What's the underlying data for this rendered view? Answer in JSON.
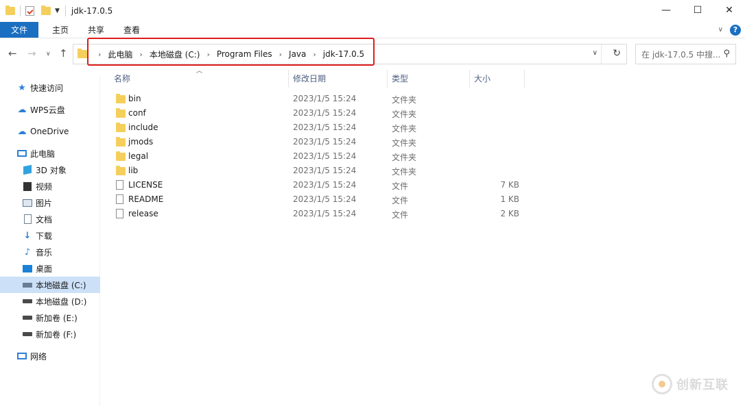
{
  "window": {
    "title": "jdk-17.0.5"
  },
  "ribbon": {
    "tabs": [
      "文件",
      "主页",
      "共享",
      "查看"
    ]
  },
  "address": {
    "crumbs": [
      "此电脑",
      "本地磁盘 (C:)",
      "Program Files",
      "Java",
      "jdk-17.0.5"
    ]
  },
  "search": {
    "placeholder": "在 jdk-17.0.5 中搜..."
  },
  "sidebar": {
    "items": [
      {
        "label": "快速访问",
        "icon": "star-icon"
      },
      {
        "label": "WPS云盘",
        "icon": "cloud-icon"
      },
      {
        "label": "OneDrive",
        "icon": "onedrive-icon"
      },
      {
        "label": "此电脑",
        "icon": "pc-icon"
      },
      {
        "label": "3D 对象",
        "icon": "3d-objects-icon"
      },
      {
        "label": "视频",
        "icon": "video-icon"
      },
      {
        "label": "图片",
        "icon": "pictures-icon"
      },
      {
        "label": "文档",
        "icon": "documents-icon"
      },
      {
        "label": "下载",
        "icon": "download-icon"
      },
      {
        "label": "音乐",
        "icon": "music-icon"
      },
      {
        "label": "桌面",
        "icon": "desktop-icon"
      },
      {
        "label": "本地磁盘 (C:)",
        "icon": "drive-icon"
      },
      {
        "label": "本地磁盘 (D:)",
        "icon": "drive-icon"
      },
      {
        "label": "新加卷 (E:)",
        "icon": "drive-icon"
      },
      {
        "label": "新加卷 (F:)",
        "icon": "drive-icon"
      },
      {
        "label": "网络",
        "icon": "network-icon"
      }
    ]
  },
  "columns": {
    "name": "名称",
    "date": "修改日期",
    "type": "类型",
    "size": "大小"
  },
  "files": [
    {
      "name": "bin",
      "date": "2023/1/5 15:24",
      "type": "文件夹",
      "size": "",
      "kind": "folder"
    },
    {
      "name": "conf",
      "date": "2023/1/5 15:24",
      "type": "文件夹",
      "size": "",
      "kind": "folder"
    },
    {
      "name": "include",
      "date": "2023/1/5 15:24",
      "type": "文件夹",
      "size": "",
      "kind": "folder"
    },
    {
      "name": "jmods",
      "date": "2023/1/5 15:24",
      "type": "文件夹",
      "size": "",
      "kind": "folder"
    },
    {
      "name": "legal",
      "date": "2023/1/5 15:24",
      "type": "文件夹",
      "size": "",
      "kind": "folder"
    },
    {
      "name": "lib",
      "date": "2023/1/5 15:24",
      "type": "文件夹",
      "size": "",
      "kind": "folder"
    },
    {
      "name": "LICENSE",
      "date": "2023/1/5 15:24",
      "type": "文件",
      "size": "7 KB",
      "kind": "file"
    },
    {
      "name": "README",
      "date": "2023/1/5 15:24",
      "type": "文件",
      "size": "1 KB",
      "kind": "file"
    },
    {
      "name": "release",
      "date": "2023/1/5 15:24",
      "type": "文件",
      "size": "2 KB",
      "kind": "file"
    }
  ],
  "watermark": {
    "text": "创新互联"
  },
  "colors": {
    "accent": "#1a6fc1",
    "highlight": "#e01b1b",
    "folder": "#f5cf5c",
    "selected": "#cce0f7"
  }
}
